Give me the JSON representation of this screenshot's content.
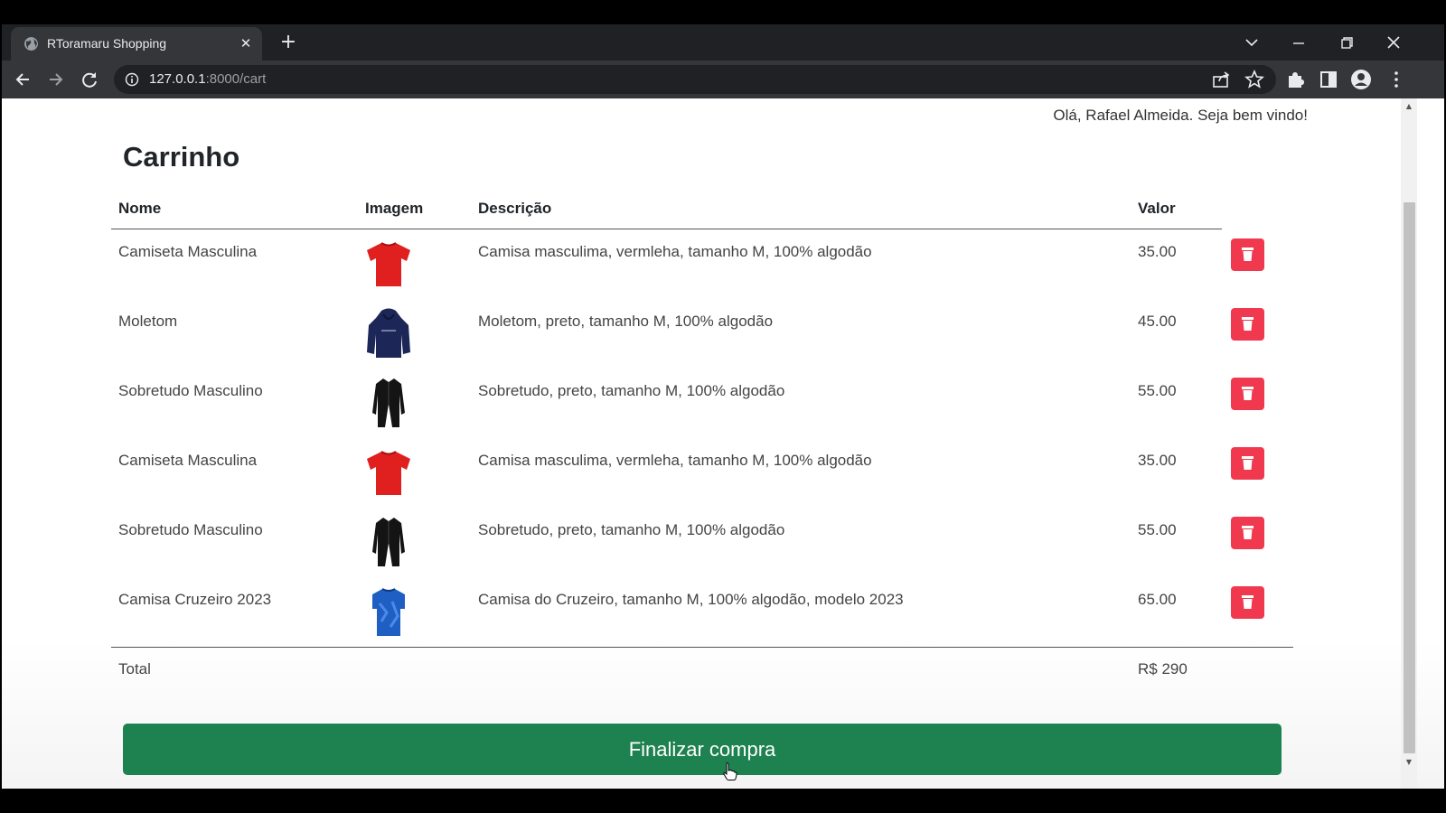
{
  "browser": {
    "tab_title": "RToramaru Shopping",
    "tab_close": "✕",
    "new_tab": "+",
    "url_host": "127.0.0.1",
    "url_path": ":8000/cart"
  },
  "page": {
    "greeting": "Olá, Rafael Almeida. Seja bem vindo!",
    "title": "Carrinho",
    "columns": {
      "name": "Nome",
      "image": "Imagem",
      "description": "Descrição",
      "value": "Valor"
    },
    "items": [
      {
        "name": "Camiseta Masculina",
        "description": "Camisa masculima, vermleha, tamanho M, 100% algodão",
        "value": "35.00",
        "image_icon": "red-tshirt-icon"
      },
      {
        "name": "Moletom",
        "description": "Moletom, preto, tamanho M, 100% algodão",
        "value": "45.00",
        "image_icon": "navy-hoodie-icon"
      },
      {
        "name": "Sobretudo Masculino",
        "description": "Sobretudo, preto, tamanho M, 100% algodão",
        "value": "55.00",
        "image_icon": "black-coat-icon"
      },
      {
        "name": "Camiseta Masculina",
        "description": "Camisa masculima, vermleha, tamanho M, 100% algodão",
        "value": "35.00",
        "image_icon": "red-tshirt-icon"
      },
      {
        "name": "Sobretudo Masculino",
        "description": "Sobretudo, preto, tamanho M, 100% algodão",
        "value": "55.00",
        "image_icon": "black-coat-icon"
      },
      {
        "name": "Camisa Cruzeiro 2023",
        "description": "Camisa do Cruzeiro, tamanho M, 100% algodão, modelo 2023",
        "value": "65.00",
        "image_icon": "blue-jersey-icon"
      }
    ],
    "total_label": "Total",
    "total_value": "R$ 290",
    "checkout_label": "Finalizar compra"
  },
  "colors": {
    "delete_button": "#f0394f",
    "checkout_button": "#1e8250",
    "browser_chrome": "#35363a"
  }
}
